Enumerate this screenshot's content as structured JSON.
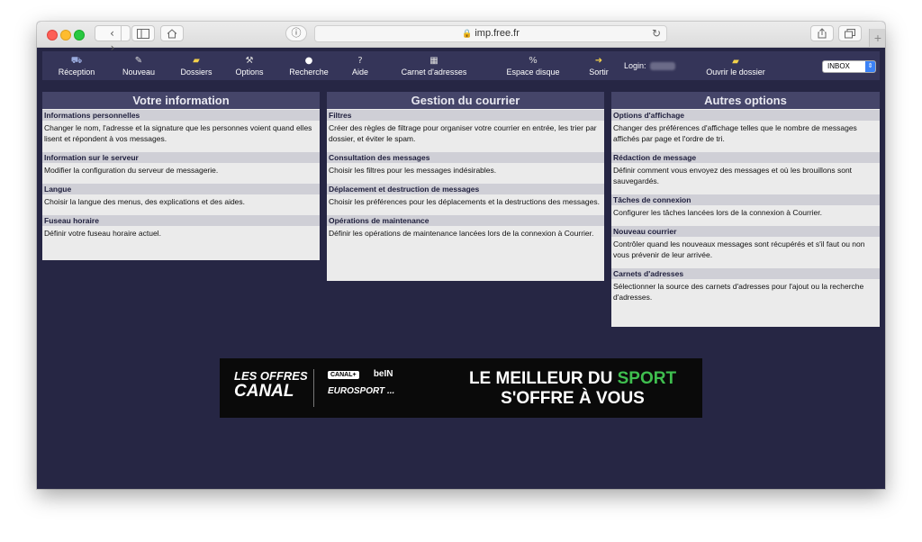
{
  "browser": {
    "url": "imp.free.fr",
    "nav_back": "‹",
    "nav_forward": "›",
    "reload": "↻",
    "reader": "ⓘ",
    "new_tab": "+"
  },
  "toolbar": {
    "items": [
      {
        "label": "Réception",
        "icon": "inbox-tray-icon"
      },
      {
        "label": "Nouveau",
        "icon": "compose-icon"
      },
      {
        "label": "Dossiers",
        "icon": "folders-icon"
      },
      {
        "label": "Options",
        "icon": "options-icon"
      },
      {
        "label": "Recherche",
        "icon": "search-icon"
      },
      {
        "label": "Aide",
        "icon": "help-icon"
      },
      {
        "label": "Carnet d'adresses",
        "icon": "addressbook-icon"
      },
      {
        "label": "Espace disque",
        "icon": "percent-icon"
      },
      {
        "label": "Sortir",
        "icon": "logout-icon"
      }
    ],
    "login_label": "Login:",
    "open_folder_label": "Ouvrir le dossier",
    "folder_select_value": "INBOX"
  },
  "panels": [
    {
      "title": "Votre information",
      "sections": [
        {
          "title": "Informations personnelles",
          "desc": "Changer le nom, l'adresse et la signature que les personnes voient quand elles lisent et répondent à vos messages."
        },
        {
          "title": "Information sur le serveur",
          "desc": "Modifier la configuration du serveur de messagerie."
        },
        {
          "title": "Langue",
          "desc": "Choisir la langue des menus, des explications et des aides."
        },
        {
          "title": "Fuseau horaire",
          "desc": "Définir votre fuseau horaire actuel."
        }
      ]
    },
    {
      "title": "Gestion du courrier",
      "sections": [
        {
          "title": "Filtres",
          "desc": "Créer des règles de filtrage pour organiser votre courrier en entrée, les trier par dossier, et éviter le spam."
        },
        {
          "title": "Consultation des messages",
          "desc": "Choisir les filtres pour les messages indésirables."
        },
        {
          "title": "Déplacement et destruction de messages",
          "desc": "Choisir les préférences pour les déplacements et la destructions des messages."
        },
        {
          "title": "Opérations de maintenance",
          "desc": "Définir les opérations de maintenance lancées lors de la connexion à Courrier."
        }
      ]
    },
    {
      "title": "Autres options",
      "sections": [
        {
          "title": "Options d'affichage",
          "desc": "Changer des préférences d'affichage telles que le nombre de messages affichés par page et l'ordre de tri."
        },
        {
          "title": "Rédaction de message",
          "desc": "Définir comment vous envoyez des messages et où les brouillons sont sauvegardés."
        },
        {
          "title": "Tâches de connexion",
          "desc": "Configurer les tâches lancées lors de la connexion à Courrier."
        },
        {
          "title": "Nouveau courrier",
          "desc": "Contrôler quand les nouveaux messages sont récupérés et s'il faut ou non vous prévenir de leur arrivée."
        },
        {
          "title": "Carnets d'adresses",
          "desc": "Sélectionner la source des carnets d'adresses pour l'ajout ou la recherche d'adresses."
        }
      ]
    }
  ],
  "ad": {
    "left_line1": "LES OFFRES",
    "left_line2": "CANAL",
    "canal_plus": "CANAL+",
    "bein": "beIN",
    "eurosport": "EUROSPORT ...",
    "right_line1_a": "LE MEILLEUR DU ",
    "right_line1_b": "SPORT",
    "right_line2": "S'OFFRE À VOUS"
  }
}
